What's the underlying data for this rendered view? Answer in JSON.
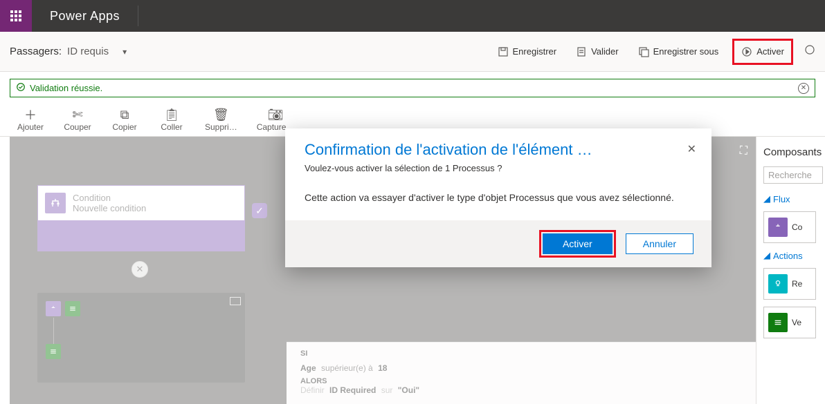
{
  "header": {
    "app_title": "Power Apps"
  },
  "crumb": {
    "entity": "Passagers:",
    "flow": "ID requis"
  },
  "actions": {
    "save": "Enregistrer",
    "validate": "Valider",
    "save_as": "Enregistrer sous",
    "activate": "Activer"
  },
  "validation": {
    "text": "Validation réussie."
  },
  "toolbar": {
    "add": "Ajouter",
    "cut": "Couper",
    "copy": "Copier",
    "paste": "Coller",
    "delete": "Suppri…",
    "snapshot": "Capture…"
  },
  "canvas": {
    "condition_title": "Condition",
    "condition_sub": "Nouvelle condition"
  },
  "details": {
    "si": "SI",
    "age_label": "Age",
    "age_rest": "supérieur(e) à",
    "age_val": "18",
    "alors": "ALORS",
    "define_prefix": "Définir",
    "define_field": "ID Required",
    "define_mid": "sur",
    "define_val": "\"Oui\""
  },
  "right": {
    "title": "Composants",
    "search": "Recherche",
    "flux": "Flux",
    "flux_tile": "Co",
    "actions": "Actions",
    "actions_tile1": "Re",
    "actions_tile2": "Ve"
  },
  "modal": {
    "title": "Confirmation de l'activation de l'élément …",
    "question": "Voulez-vous activer la sélection de 1 Processus ?",
    "body": "Cette action va essayer d'activer le type d'objet Processus que vous avez sélectionné.",
    "activate": "Activer",
    "cancel": "Annuler"
  }
}
